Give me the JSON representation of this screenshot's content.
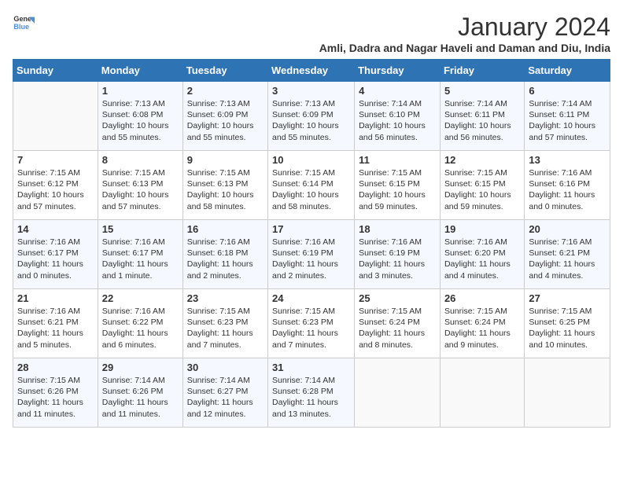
{
  "logo": {
    "line1": "General",
    "line2": "Blue"
  },
  "title": "January 2024",
  "subtitle": "Amli, Dadra and Nagar Haveli and Daman and Diu, India",
  "weekdays": [
    "Sunday",
    "Monday",
    "Tuesday",
    "Wednesday",
    "Thursday",
    "Friday",
    "Saturday"
  ],
  "weeks": [
    [
      {
        "day": "",
        "info": ""
      },
      {
        "day": "1",
        "info": "Sunrise: 7:13 AM\nSunset: 6:08 PM\nDaylight: 10 hours and 55 minutes."
      },
      {
        "day": "2",
        "info": "Sunrise: 7:13 AM\nSunset: 6:09 PM\nDaylight: 10 hours and 55 minutes."
      },
      {
        "day": "3",
        "info": "Sunrise: 7:13 AM\nSunset: 6:09 PM\nDaylight: 10 hours and 55 minutes."
      },
      {
        "day": "4",
        "info": "Sunrise: 7:14 AM\nSunset: 6:10 PM\nDaylight: 10 hours and 56 minutes."
      },
      {
        "day": "5",
        "info": "Sunrise: 7:14 AM\nSunset: 6:11 PM\nDaylight: 10 hours and 56 minutes."
      },
      {
        "day": "6",
        "info": "Sunrise: 7:14 AM\nSunset: 6:11 PM\nDaylight: 10 hours and 57 minutes."
      }
    ],
    [
      {
        "day": "7",
        "info": "Sunrise: 7:15 AM\nSunset: 6:12 PM\nDaylight: 10 hours and 57 minutes."
      },
      {
        "day": "8",
        "info": "Sunrise: 7:15 AM\nSunset: 6:13 PM\nDaylight: 10 hours and 57 minutes."
      },
      {
        "day": "9",
        "info": "Sunrise: 7:15 AM\nSunset: 6:13 PM\nDaylight: 10 hours and 58 minutes."
      },
      {
        "day": "10",
        "info": "Sunrise: 7:15 AM\nSunset: 6:14 PM\nDaylight: 10 hours and 58 minutes."
      },
      {
        "day": "11",
        "info": "Sunrise: 7:15 AM\nSunset: 6:15 PM\nDaylight: 10 hours and 59 minutes."
      },
      {
        "day": "12",
        "info": "Sunrise: 7:15 AM\nSunset: 6:15 PM\nDaylight: 10 hours and 59 minutes."
      },
      {
        "day": "13",
        "info": "Sunrise: 7:16 AM\nSunset: 6:16 PM\nDaylight: 11 hours and 0 minutes."
      }
    ],
    [
      {
        "day": "14",
        "info": "Sunrise: 7:16 AM\nSunset: 6:17 PM\nDaylight: 11 hours and 0 minutes."
      },
      {
        "day": "15",
        "info": "Sunrise: 7:16 AM\nSunset: 6:17 PM\nDaylight: 11 hours and 1 minute."
      },
      {
        "day": "16",
        "info": "Sunrise: 7:16 AM\nSunset: 6:18 PM\nDaylight: 11 hours and 2 minutes."
      },
      {
        "day": "17",
        "info": "Sunrise: 7:16 AM\nSunset: 6:19 PM\nDaylight: 11 hours and 2 minutes."
      },
      {
        "day": "18",
        "info": "Sunrise: 7:16 AM\nSunset: 6:19 PM\nDaylight: 11 hours and 3 minutes."
      },
      {
        "day": "19",
        "info": "Sunrise: 7:16 AM\nSunset: 6:20 PM\nDaylight: 11 hours and 4 minutes."
      },
      {
        "day": "20",
        "info": "Sunrise: 7:16 AM\nSunset: 6:21 PM\nDaylight: 11 hours and 4 minutes."
      }
    ],
    [
      {
        "day": "21",
        "info": "Sunrise: 7:16 AM\nSunset: 6:21 PM\nDaylight: 11 hours and 5 minutes."
      },
      {
        "day": "22",
        "info": "Sunrise: 7:16 AM\nSunset: 6:22 PM\nDaylight: 11 hours and 6 minutes."
      },
      {
        "day": "23",
        "info": "Sunrise: 7:15 AM\nSunset: 6:23 PM\nDaylight: 11 hours and 7 minutes."
      },
      {
        "day": "24",
        "info": "Sunrise: 7:15 AM\nSunset: 6:23 PM\nDaylight: 11 hours and 7 minutes."
      },
      {
        "day": "25",
        "info": "Sunrise: 7:15 AM\nSunset: 6:24 PM\nDaylight: 11 hours and 8 minutes."
      },
      {
        "day": "26",
        "info": "Sunrise: 7:15 AM\nSunset: 6:24 PM\nDaylight: 11 hours and 9 minutes."
      },
      {
        "day": "27",
        "info": "Sunrise: 7:15 AM\nSunset: 6:25 PM\nDaylight: 11 hours and 10 minutes."
      }
    ],
    [
      {
        "day": "28",
        "info": "Sunrise: 7:15 AM\nSunset: 6:26 PM\nDaylight: 11 hours and 11 minutes."
      },
      {
        "day": "29",
        "info": "Sunrise: 7:14 AM\nSunset: 6:26 PM\nDaylight: 11 hours and 11 minutes."
      },
      {
        "day": "30",
        "info": "Sunrise: 7:14 AM\nSunset: 6:27 PM\nDaylight: 11 hours and 12 minutes."
      },
      {
        "day": "31",
        "info": "Sunrise: 7:14 AM\nSunset: 6:28 PM\nDaylight: 11 hours and 13 minutes."
      },
      {
        "day": "",
        "info": ""
      },
      {
        "day": "",
        "info": ""
      },
      {
        "day": "",
        "info": ""
      }
    ]
  ]
}
